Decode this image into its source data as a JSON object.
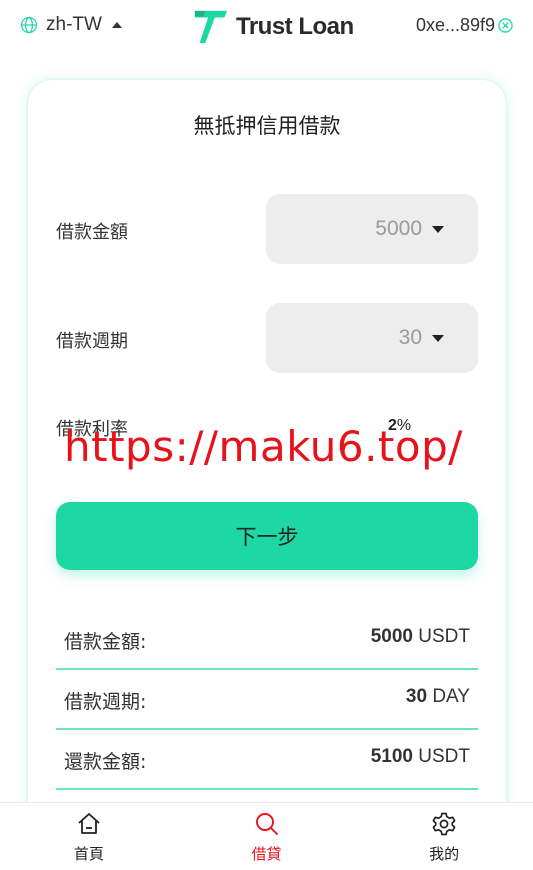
{
  "header": {
    "language": "zh-TW",
    "brand": "Trust Loan",
    "wallet_address": "0xe...89f9"
  },
  "card": {
    "title": "無抵押信用借款",
    "amount": {
      "label": "借款金額",
      "value": "5000"
    },
    "period": {
      "label": "借款週期",
      "value": "30"
    },
    "rate": {
      "label": "借款利率",
      "value": "2",
      "unit": "%"
    },
    "next_button": "下一步"
  },
  "summary": [
    {
      "label": "借款金額:",
      "value": "5000",
      "unit": "USDT"
    },
    {
      "label": "借款週期:",
      "value": "30",
      "unit": "DAY"
    },
    {
      "label": "還款金額:",
      "value": "5100",
      "unit": "USDT"
    }
  ],
  "watermark": "https://maku6.top/",
  "bottom_nav": [
    {
      "label": "首頁",
      "icon": "home-icon",
      "active": false
    },
    {
      "label": "借貸",
      "icon": "search-icon",
      "active": true
    },
    {
      "label": "我的",
      "icon": "gear-icon",
      "active": false
    }
  ],
  "colors": {
    "accent": "#1dd8a3",
    "active_nav": "#e8121a",
    "watermark": "#e8121a"
  }
}
